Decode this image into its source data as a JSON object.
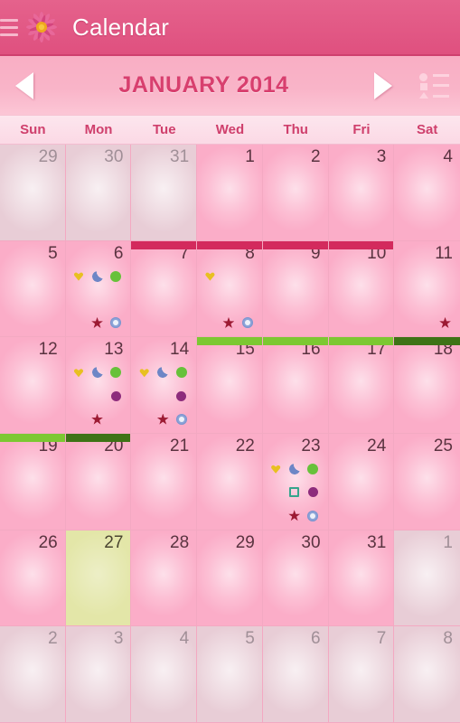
{
  "appbar": {
    "title": "Calendar",
    "menu_icon": "hamburger-icon",
    "logo_icon": "flower-logo-icon"
  },
  "monthbar": {
    "prev_label": "",
    "next_label": "",
    "title": "JANUARY 2014",
    "prev_icon": "triangle-left-icon",
    "next_icon": "triangle-right-icon",
    "legend_icon": "legend-list-icon"
  },
  "weekdays": [
    "Sun",
    "Mon",
    "Tue",
    "Wed",
    "Thu",
    "Fri",
    "Sat"
  ],
  "colors": {
    "appbar": "#e0537f",
    "monthbar": "#f9b0c6",
    "cell": "#fbadc8",
    "cell_outside": "#e8cdd6",
    "today": "#e3e6a8",
    "period_crimson": "#d32a5d",
    "fertile_green": "#7cc832",
    "ovulation_green": "#3e7316",
    "grid_line": "#f3a9c2",
    "month_title": "#d83f6e",
    "weekday_text": "#cf3f6c",
    "day_text": "#5a3340",
    "day_text_outside": "#a08f97"
  },
  "marker_legend": {
    "heart": "yellow-heart-icon",
    "moon": "blue-crescent-moon-icon",
    "circle-green": "green-circle-icon",
    "circle-purple": "purple-circle-icon",
    "square-teal": "teal-square-icon",
    "star": "red-star-icon",
    "flower-blue": "blue-flower-icon"
  },
  "days": [
    {
      "n": "29",
      "out": true
    },
    {
      "n": "30",
      "out": true
    },
    {
      "n": "31",
      "out": true
    },
    {
      "n": "1"
    },
    {
      "n": "2"
    },
    {
      "n": "3"
    },
    {
      "n": "4"
    },
    {
      "n": "5"
    },
    {
      "n": "6",
      "marks": [
        {
          "slot": 1,
          "type": "heart"
        },
        {
          "slot": 2,
          "type": "moon"
        },
        {
          "slot": 3,
          "type": "circle-green"
        },
        {
          "slot": 8,
          "type": "star"
        },
        {
          "slot": 9,
          "type": "flower-blue"
        }
      ]
    },
    {
      "n": "7",
      "bar": "crimson"
    },
    {
      "n": "8",
      "bar": "crimson",
      "marks": [
        {
          "slot": 1,
          "type": "heart"
        },
        {
          "slot": 8,
          "type": "star"
        },
        {
          "slot": 9,
          "type": "flower-blue"
        }
      ]
    },
    {
      "n": "9",
      "bar": "crimson"
    },
    {
      "n": "10",
      "bar": "crimson"
    },
    {
      "n": "11",
      "marks": [
        {
          "slot": 9,
          "type": "star"
        }
      ]
    },
    {
      "n": "12"
    },
    {
      "n": "13",
      "marks": [
        {
          "slot": 1,
          "type": "heart"
        },
        {
          "slot": 2,
          "type": "moon"
        },
        {
          "slot": 3,
          "type": "circle-green"
        },
        {
          "slot": 6,
          "type": "circle-purple"
        },
        {
          "slot": 8,
          "type": "star"
        }
      ]
    },
    {
      "n": "14",
      "marks": [
        {
          "slot": 1,
          "type": "heart"
        },
        {
          "slot": 2,
          "type": "moon"
        },
        {
          "slot": 3,
          "type": "circle-green"
        },
        {
          "slot": 6,
          "type": "circle-purple"
        },
        {
          "slot": 8,
          "type": "star"
        },
        {
          "slot": 9,
          "type": "flower-blue"
        }
      ]
    },
    {
      "n": "15",
      "bar": "green"
    },
    {
      "n": "16",
      "bar": "green"
    },
    {
      "n": "17",
      "bar": "green"
    },
    {
      "n": "18",
      "bar": "greendark"
    },
    {
      "n": "19",
      "bar": "green"
    },
    {
      "n": "20",
      "bar": "greendark"
    },
    {
      "n": "21"
    },
    {
      "n": "22"
    },
    {
      "n": "23",
      "marks": [
        {
          "slot": 1,
          "type": "heart"
        },
        {
          "slot": 2,
          "type": "moon"
        },
        {
          "slot": 3,
          "type": "circle-green"
        },
        {
          "slot": 5,
          "type": "square-teal"
        },
        {
          "slot": 6,
          "type": "circle-purple"
        },
        {
          "slot": 8,
          "type": "star"
        },
        {
          "slot": 9,
          "type": "flower-blue"
        }
      ]
    },
    {
      "n": "24"
    },
    {
      "n": "25"
    },
    {
      "n": "26"
    },
    {
      "n": "27",
      "today": true
    },
    {
      "n": "28"
    },
    {
      "n": "29"
    },
    {
      "n": "30"
    },
    {
      "n": "31"
    },
    {
      "n": "1",
      "out": true
    },
    {
      "n": "2",
      "out": true
    },
    {
      "n": "3",
      "out": true
    },
    {
      "n": "4",
      "out": true
    },
    {
      "n": "5",
      "out": true
    },
    {
      "n": "6",
      "out": true
    },
    {
      "n": "7",
      "out": true
    },
    {
      "n": "8",
      "out": true
    }
  ]
}
